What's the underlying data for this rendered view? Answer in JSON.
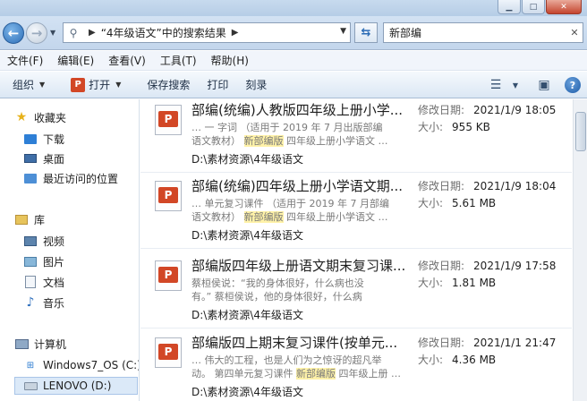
{
  "address": {
    "path_label": "“4年级语文”中的搜索结果"
  },
  "search": {
    "value": "新部编"
  },
  "menu": [
    {
      "label": "文件(F)"
    },
    {
      "label": "编辑(E)"
    },
    {
      "label": "查看(V)"
    },
    {
      "label": "工具(T)"
    },
    {
      "label": "帮助(H)"
    }
  ],
  "toolbar": {
    "organize": "组织",
    "open": "打开",
    "save_search": "保存搜索",
    "print": "打印",
    "burn": "刻录"
  },
  "nav": {
    "favorites": "收藏夹",
    "downloads": "下载",
    "desktop": "桌面",
    "recent": "最近访问的位置",
    "libraries": "库",
    "videos": "视频",
    "pictures": "图片",
    "documents": "文档",
    "music": "音乐",
    "computer": "计算机",
    "drive_c": "Windows7_OS (C:)",
    "drive_d": "LENOVO (D:)"
  },
  "labels": {
    "modified": "修改日期:",
    "size": "大小:"
  },
  "results": [
    {
      "title": "部编(统编)人教版四年级上册小学...",
      "snippet1": "… 一 字词 （适用于 2019 年 7 月出版部编",
      "snippet2_pre": "语文教材） ",
      "snippet2_hl": "新部编版",
      "snippet2_post": " 四年级上册小学语文 …",
      "path": "D:\\素材资源\\4年级语文",
      "date": "2021/1/9 18:05",
      "size": "955 KB"
    },
    {
      "title": "部编(统编)四年级上册小学语文期...",
      "snippet1": "… 单元复习课件 （适用于 2019 年 7 月部编",
      "snippet2_pre": "语文教材） ",
      "snippet2_hl": "新部编版",
      "snippet2_post": " 四年级上册小学语文 …",
      "path": "D:\\素材资源\\4年级语文",
      "date": "2021/1/9 18:04",
      "size": "5.61 MB"
    },
    {
      "title": "部编版四年级上册语文期末复习课...",
      "snippet1": "蔡桓侯说：“我的身体很好，什么病也没",
      "snippet2_pre": "有。” 蔡桓侯说，他的身体很好，什么病",
      "snippet2_hl": "",
      "snippet2_post": "",
      "path": "D:\\素材资源\\4年级语文",
      "date": "2021/1/9 17:58",
      "size": "1.81 MB"
    },
    {
      "title": "部编版四上期末复习课件(按单元...",
      "snippet1": "… 伟大的工程，也是人们为之惊讶的超凡举",
      "snippet2_pre": "动。 第四单元复习课件 ",
      "snippet2_hl": "新部编版",
      "snippet2_post": " 四年级上册 …",
      "path": "D:\\素材资源\\4年级语文",
      "date": "2021/1/1 21:47",
      "size": "4.36 MB"
    }
  ]
}
